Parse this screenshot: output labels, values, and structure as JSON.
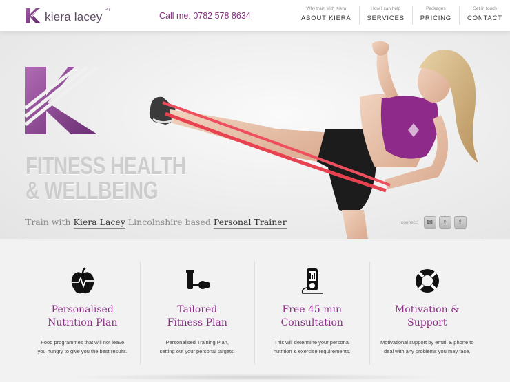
{
  "brand": {
    "name": "kiera lacey",
    "suffix": "PT",
    "accent": "#8b2f86"
  },
  "header": {
    "call": "Call me: 0782 578 8634",
    "nav": [
      {
        "sub": "Why train with Kiera",
        "label": "ABOUT KIERA"
      },
      {
        "sub": "How I can help",
        "label": "SERVICES"
      },
      {
        "sub": "Packages",
        "label": "PRICING"
      },
      {
        "sub": "Get in touch",
        "label": "CONTACT"
      }
    ]
  },
  "hero": {
    "headline_line1": "FITNESS HEALTH",
    "headline_line2": "& WELLBEING",
    "tagline_pre": "Train with ",
    "tagline_name": "Kiera Lacey",
    "tagline_mid": " Lincolnshire based ",
    "tagline_role": "Personal Trainer",
    "connect_label": "connect:",
    "social": [
      {
        "icon": "email-icon",
        "glyph": "✉"
      },
      {
        "icon": "twitter-icon",
        "glyph": "t"
      },
      {
        "icon": "facebook-icon",
        "glyph": "f"
      }
    ]
  },
  "features": [
    {
      "icon": "apple-heartbeat-icon",
      "title1": "Personalised",
      "title2": "Nutrition Plan",
      "text1": "Food programmes that will not leave",
      "text2": "you hungry to give you the best results."
    },
    {
      "icon": "dumbbell-icon",
      "title1": "Tailored",
      "title2": "Fitness Plan",
      "text1": "Personalised Training Plan,",
      "text2": "setting out your personal targets."
    },
    {
      "icon": "mp3-player-icon",
      "title1": "Free 45 min",
      "title2": "Consultation",
      "text1": "This will determine your personal",
      "text2": "nutrition & exercise requirements."
    },
    {
      "icon": "life-ring-icon",
      "title1": "Motivation &",
      "title2": "Support",
      "text1": "Motivational support by email & phone to",
      "text2": "deal with any problems you may face."
    }
  ]
}
